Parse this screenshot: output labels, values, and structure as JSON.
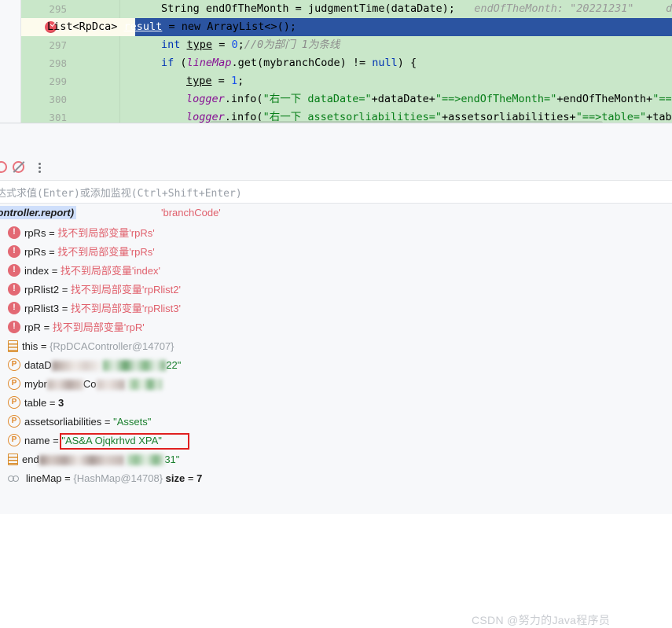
{
  "editor": {
    "gutter_lines": [
      "295",
      "",
      "297",
      "298",
      "299",
      "300",
      "301"
    ],
    "breakpoint_line_number": "296",
    "lines": [
      {
        "num": "295",
        "tokens": [
          {
            "t": "String ",
            "c": "plain"
          },
          {
            "t": "endOfTheMonth ",
            "c": "plain"
          },
          {
            "t": "= judgmentTime(dataDate);",
            "c": "plain"
          }
        ],
        "inline_hints": [
          "endOfTheMonth: \"20221231\"",
          "dat"
        ]
      },
      {
        "num": "296",
        "selected": true,
        "text": "List<RpDca> result = new ArrayList<>();"
      },
      {
        "num": "297",
        "text": "int type = 0;//0为部门 1为条线"
      },
      {
        "num": "298",
        "text": "if (lineMap.get(mybranchCode) != null) {"
      },
      {
        "num": "299",
        "text": "type = 1;"
      },
      {
        "num": "300",
        "text": "logger.info(\"右一下 dataDate=\"+dataDate+\"==>endOfTheMonth=\"+endOfTheMonth+\"==>"
      },
      {
        "num": "301",
        "text": "logger.info(\"右一下 assetsorliabilities=\"+assetsorliabilities+\"==>table=\"+tabl"
      }
    ]
  },
  "toolbar": {
    "mute_breakpoints_label": "Mute Breakpoints",
    "view_breakpoints_label": "View Breakpoints",
    "more_label": "More"
  },
  "evaluate": {
    "placeholder": "表达式求值(Enter)或添加监视(Ctrl+Shift+Enter)"
  },
  "context": {
    "class_package": "(com.boc.web.controller.report)",
    "expression": "'branchCode'"
  },
  "variables": [
    {
      "icon": "error-icon",
      "name": "rpRs",
      "eq": "=",
      "value": "找不到局部变量'rpRs'",
      "value_class": "var-err"
    },
    {
      "icon": "error-icon",
      "name": "rpRs",
      "eq": "=",
      "value": "找不到局部变量'rpRs'",
      "value_class": "var-err"
    },
    {
      "icon": "error-icon",
      "name": "index",
      "eq": "=",
      "value": "找不到局部变量'index'",
      "value_class": "var-err"
    },
    {
      "icon": "error-icon",
      "name": "rpRlist2",
      "eq": "=",
      "value": "找不到局部变量'rpRlist2'",
      "value_class": "var-err"
    },
    {
      "icon": "error-icon",
      "name": "rpRlist3",
      "eq": "=",
      "value": "找不到局部变量'rpRlist3'",
      "value_class": "var-err"
    },
    {
      "icon": "error-icon",
      "name": "rpR",
      "eq": "=",
      "value": "找不到局部变量'rpR'",
      "value_class": "var-err"
    },
    {
      "icon": "object-icon",
      "name": "this",
      "eq": "=",
      "value": "{RpDCAController@14707}",
      "value_class": "var-obj"
    },
    {
      "icon": "parameter-icon",
      "name": "dataD",
      "eq": "",
      "value": "22\"",
      "value_class": "var-str",
      "redacted": true
    },
    {
      "icon": "parameter-icon",
      "name": "mybr",
      "eq": "",
      "value": "",
      "value_class": "var-str",
      "redacted": true
    },
    {
      "icon": "parameter-icon",
      "name": "table",
      "eq": "=",
      "value": "3",
      "value_class": "var-num"
    },
    {
      "icon": "parameter-icon",
      "name": "assetsorliabilities",
      "eq": "=",
      "value": "\"Assets\"",
      "value_class": "var-str"
    },
    {
      "icon": "parameter-icon",
      "name": "name",
      "eq": "=",
      "value": "\"AS&A Ojqkrhvd  XPA\"",
      "value_class": "var-str",
      "highlighted": true
    },
    {
      "icon": "object-icon",
      "name": "end",
      "eq": "",
      "value": "31\"",
      "value_class": "var-str",
      "redacted": true
    },
    {
      "icon": "collection-icon",
      "name": "lineMap",
      "eq": "=",
      "value": "{HashMap@14708}",
      "value_class": "var-obj",
      "size_label": "size",
      "size_value": "7"
    }
  ],
  "watermark": "CSDN @努力的Java程序员",
  "colors": {
    "editor_bg": "#c9e7c9",
    "selected_line_bg": "#2b54a1",
    "error_red": "#e0606c",
    "string_green": "#1a7f2e",
    "keyword_blue": "#0033b3",
    "field_purple": "#871094",
    "highlight_box": "#e02020",
    "panel_bg": "#f7f8fa"
  }
}
